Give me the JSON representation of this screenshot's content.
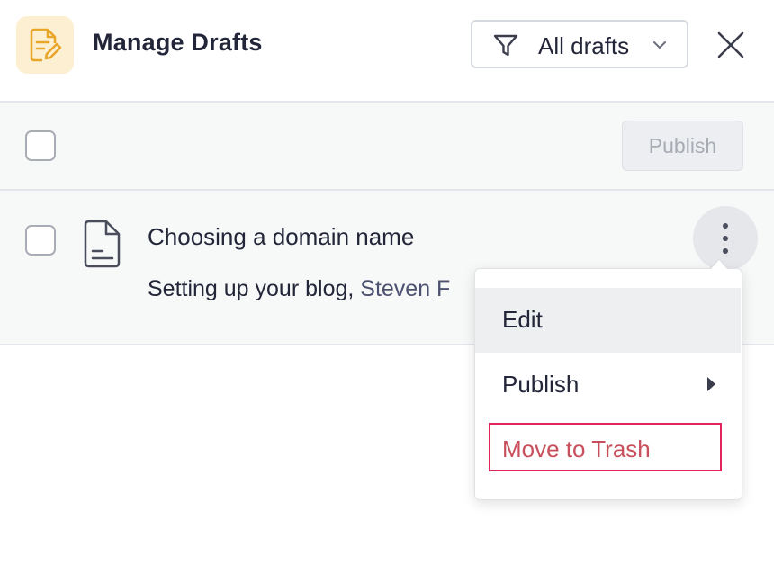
{
  "header": {
    "title": "Manage Drafts",
    "app_icon": "document-edit-icon",
    "filter": {
      "label": "All drafts",
      "icon": "filter-icon",
      "chevron": "chevron-down-icon"
    },
    "close_icon": "close-icon"
  },
  "toolbar": {
    "publish_label": "Publish"
  },
  "drafts": [
    {
      "title": "Choosing a domain name",
      "category": "Setting up your blog,",
      "author": "Steven F",
      "icon": "document-icon"
    }
  ],
  "context_menu": {
    "items": [
      {
        "label": "Edit"
      },
      {
        "label": "Publish",
        "has_submenu": true
      },
      {
        "label": "Move to Trash",
        "danger": true
      }
    ]
  },
  "colors": {
    "accent_icon_bg": "#fdf0d2",
    "accent_icon": "#e8a62a",
    "danger": "#c8505c",
    "highlight_border": "#e2245c"
  }
}
